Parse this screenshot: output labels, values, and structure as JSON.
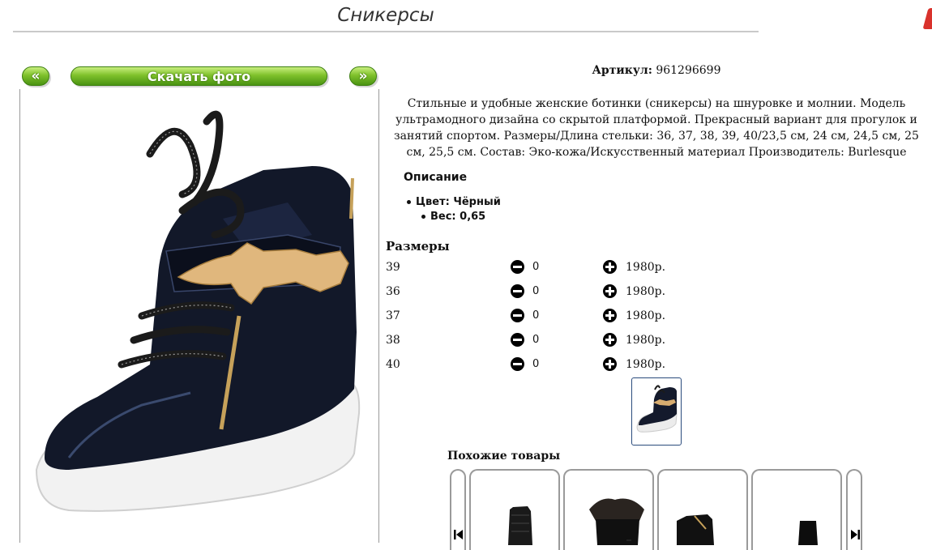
{
  "page": {
    "title": "Сникерсы"
  },
  "nav": {
    "prev_label": "«",
    "download_label": "Скачать фото",
    "next_label": "»"
  },
  "product": {
    "article_label": "Артикул:",
    "article_value": "961296699",
    "description": "Стильные и удобные женские ботинки (сникерсы) на шнуровке и молнии. Модель ультрамодного дизайна со скрытой платформой. Прекрасный вариант для прогулок и занятий спортом. Размеры/Длина стельки: 36, 37, 38, 39, 40/23,5 см, 24 см, 24,5 см, 25 см, 25,5 см. Состав: Эко-кожа/Искусственный материал Производитель: Burlesque",
    "section_title": "Описание",
    "color": "Цвет: Чёрный",
    "weight": "Вес: 0,65"
  },
  "sizes": {
    "title": "Размеры",
    "rows": [
      {
        "size": "39",
        "qty": "0",
        "price": "1980р."
      },
      {
        "size": "36",
        "qty": "0",
        "price": "1980р."
      },
      {
        "size": "37",
        "qty": "0",
        "price": "1980р."
      },
      {
        "size": "38",
        "qty": "0",
        "price": "1980р."
      },
      {
        "size": "40",
        "qty": "0",
        "price": "1980р."
      }
    ]
  },
  "similar": {
    "title": "Похожие товары"
  },
  "colors": {
    "accent_green": "#6ab023",
    "thumb_border": "#2a4b7c"
  }
}
